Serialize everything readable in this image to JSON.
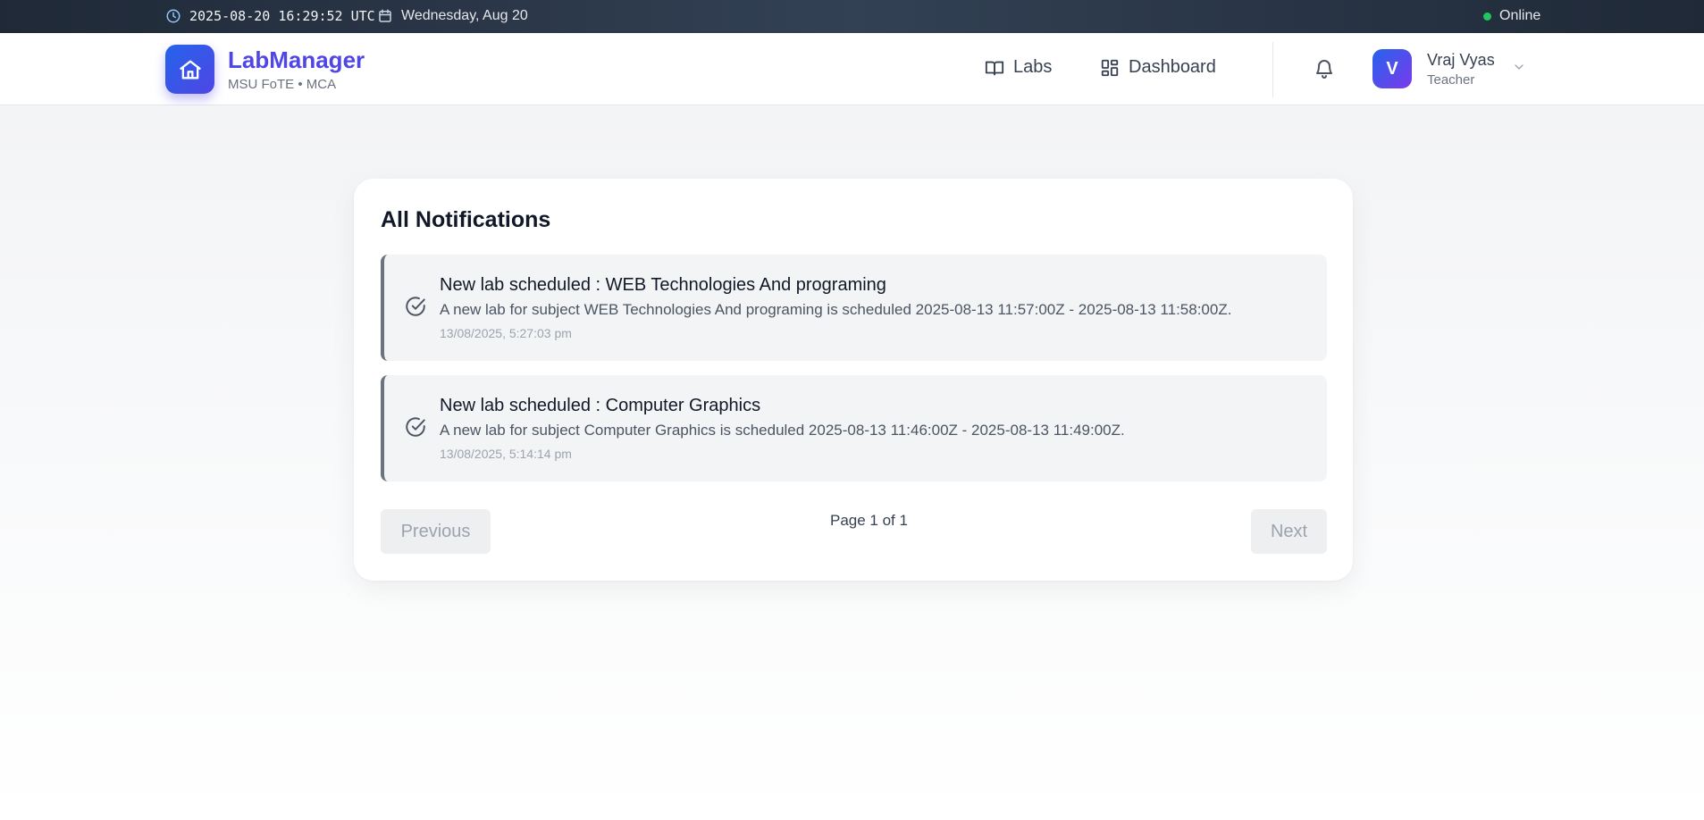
{
  "topbar": {
    "datetime": "2025-08-20 16:29:52 UTC",
    "date": "Wednesday, Aug 20",
    "status": "Online",
    "status_color": "#22c55e"
  },
  "header": {
    "brand_title": "LabManager",
    "brand_subtitle": "MSU FoTE • MCA",
    "brand_color": "#4f46e5",
    "nav": [
      {
        "label": "Labs",
        "icon": "book-open-icon"
      },
      {
        "label": "Dashboard",
        "icon": "grid-icon"
      }
    ],
    "notifications_icon": "bell-icon",
    "user": {
      "initial": "V",
      "name": "Vraj Vyas",
      "role": "Teacher"
    }
  },
  "main": {
    "title": "All Notifications",
    "notifications": [
      {
        "title": "New lab scheduled : WEB Technologies And programing",
        "body": "A new lab for subject WEB Technologies And programing is scheduled 2025-08-13 11:57:00Z - 2025-08-13 11:58:00Z.",
        "time": "13/08/2025, 5:27:03 pm",
        "icon": "check-circle-icon"
      },
      {
        "title": "New lab scheduled : Computer Graphics",
        "body": "A new lab for subject Computer Graphics is scheduled 2025-08-13 11:46:00Z - 2025-08-13 11:49:00Z.",
        "time": "13/08/2025, 5:14:14 pm",
        "icon": "check-circle-icon"
      }
    ],
    "pagination": {
      "previous_label": "Previous",
      "page_info": "Page 1 of 1",
      "next_label": "Next"
    }
  }
}
